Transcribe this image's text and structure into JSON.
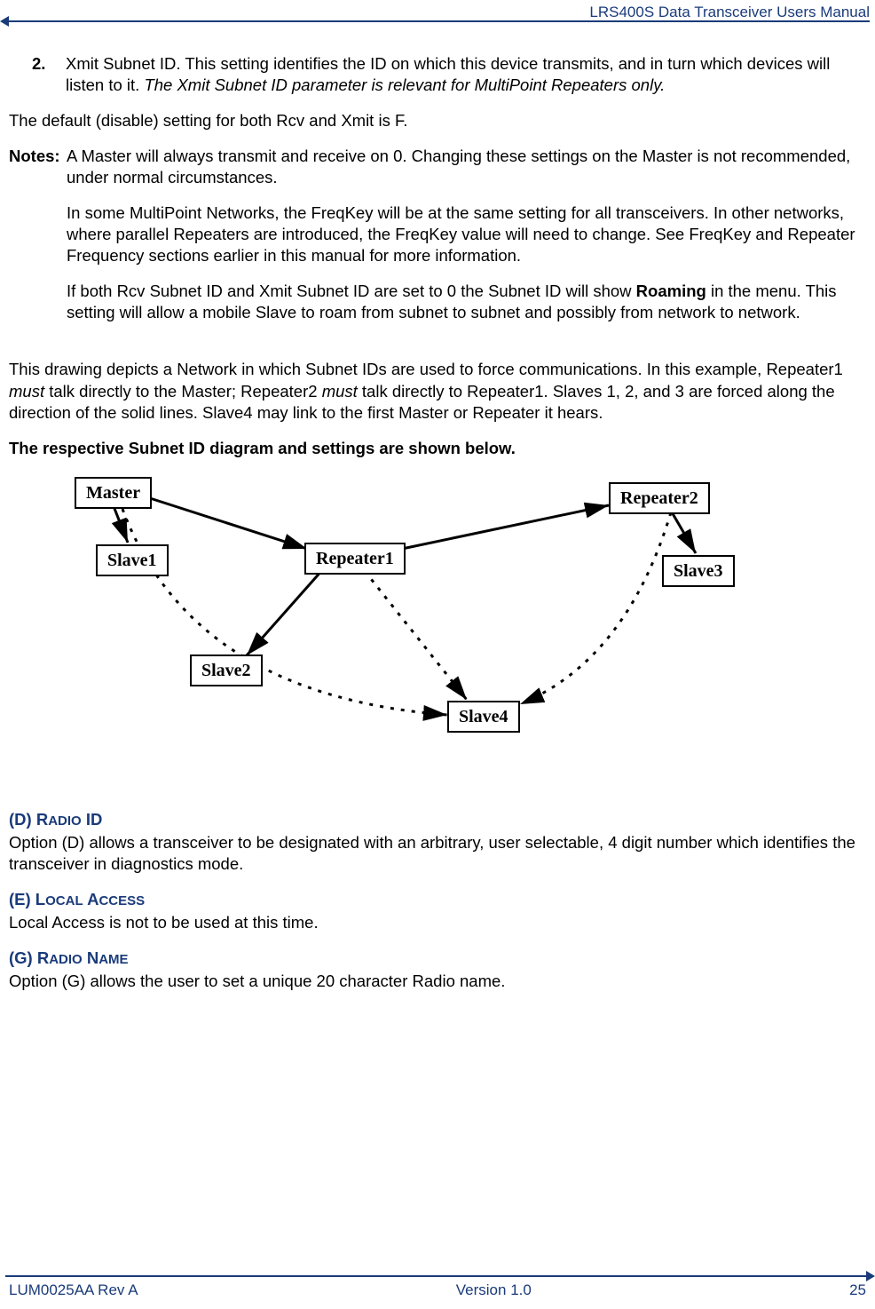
{
  "header": {
    "title": "LRS400S Data Transceiver Users Manual"
  },
  "body": {
    "item2_num": "2.",
    "item2_a": "Xmit Subnet ID.  This setting identifies the ID on which this device transmits, and in turn which devices will listen to it. ",
    "item2_b": "The Xmit Subnet ID parameter is relevant for MultiPoint Repeaters only.",
    "default_line": "The default (disable) setting for both Rcv and Xmit is F.",
    "notes_label": "Notes:",
    "notes_p1": "A Master will always transmit and receive on 0. Changing these settings on the Master is not recommended, under normal circumstances.",
    "notes_p2": "In some MultiPoint Networks, the FreqKey will be at the same setting for all transceivers.  In other networks, where parallel Repeaters are introduced, the FreqKey value will need to change.  See FreqKey and Repeater Frequency sections earlier in this manual for more information.",
    "notes_p3_a": "If both Rcv Subnet ID and Xmit Subnet ID are set to 0 the Subnet ID will show ",
    "notes_p3_b": "Roaming",
    "notes_p3_c": " in the menu.  This setting will allow a mobile Slave to roam from subnet to subnet and possibly from network to network.",
    "drawing_p_a": "This drawing depicts a Network in which Subnet IDs are used to force communications.  In this example, Repeater1 ",
    "drawing_p_b": "must",
    "drawing_p_c": " talk directly to the Master; Repeater2 ",
    "drawing_p_d": "must",
    "drawing_p_e": " talk directly to Repeater1.  Slaves 1, 2, and 3 are forced along the direction of the solid lines.  Slave4 may link to the first Master or Repeater it hears.",
    "diagram_heading": "The respective Subnet ID diagram and settings are shown below.",
    "nodes": {
      "master": "Master",
      "slave1": "Slave1",
      "repeater1": "Repeater1",
      "slave2": "Slave2",
      "slave4": "Slave4",
      "repeater2": "Repeater2",
      "slave3": "Slave3"
    },
    "sec_d_head": "(D) RADIO ID",
    "sec_d_body": "Option (D) allows a transceiver to be designated with an arbitrary, user selectable, 4 digit number which identifies the transceiver in diagnostics mode.",
    "sec_e_head": "(E) LOCAL ACCESS",
    "sec_e_body": "Local Access is not to be used at this time.",
    "sec_g_head": "(G) RADIO NAME",
    "sec_g_body": "Option (G) allows the user to set a unique 20 character Radio name."
  },
  "footer": {
    "left": "LUM0025AA Rev A",
    "center": "Version 1.0",
    "right": "25"
  }
}
